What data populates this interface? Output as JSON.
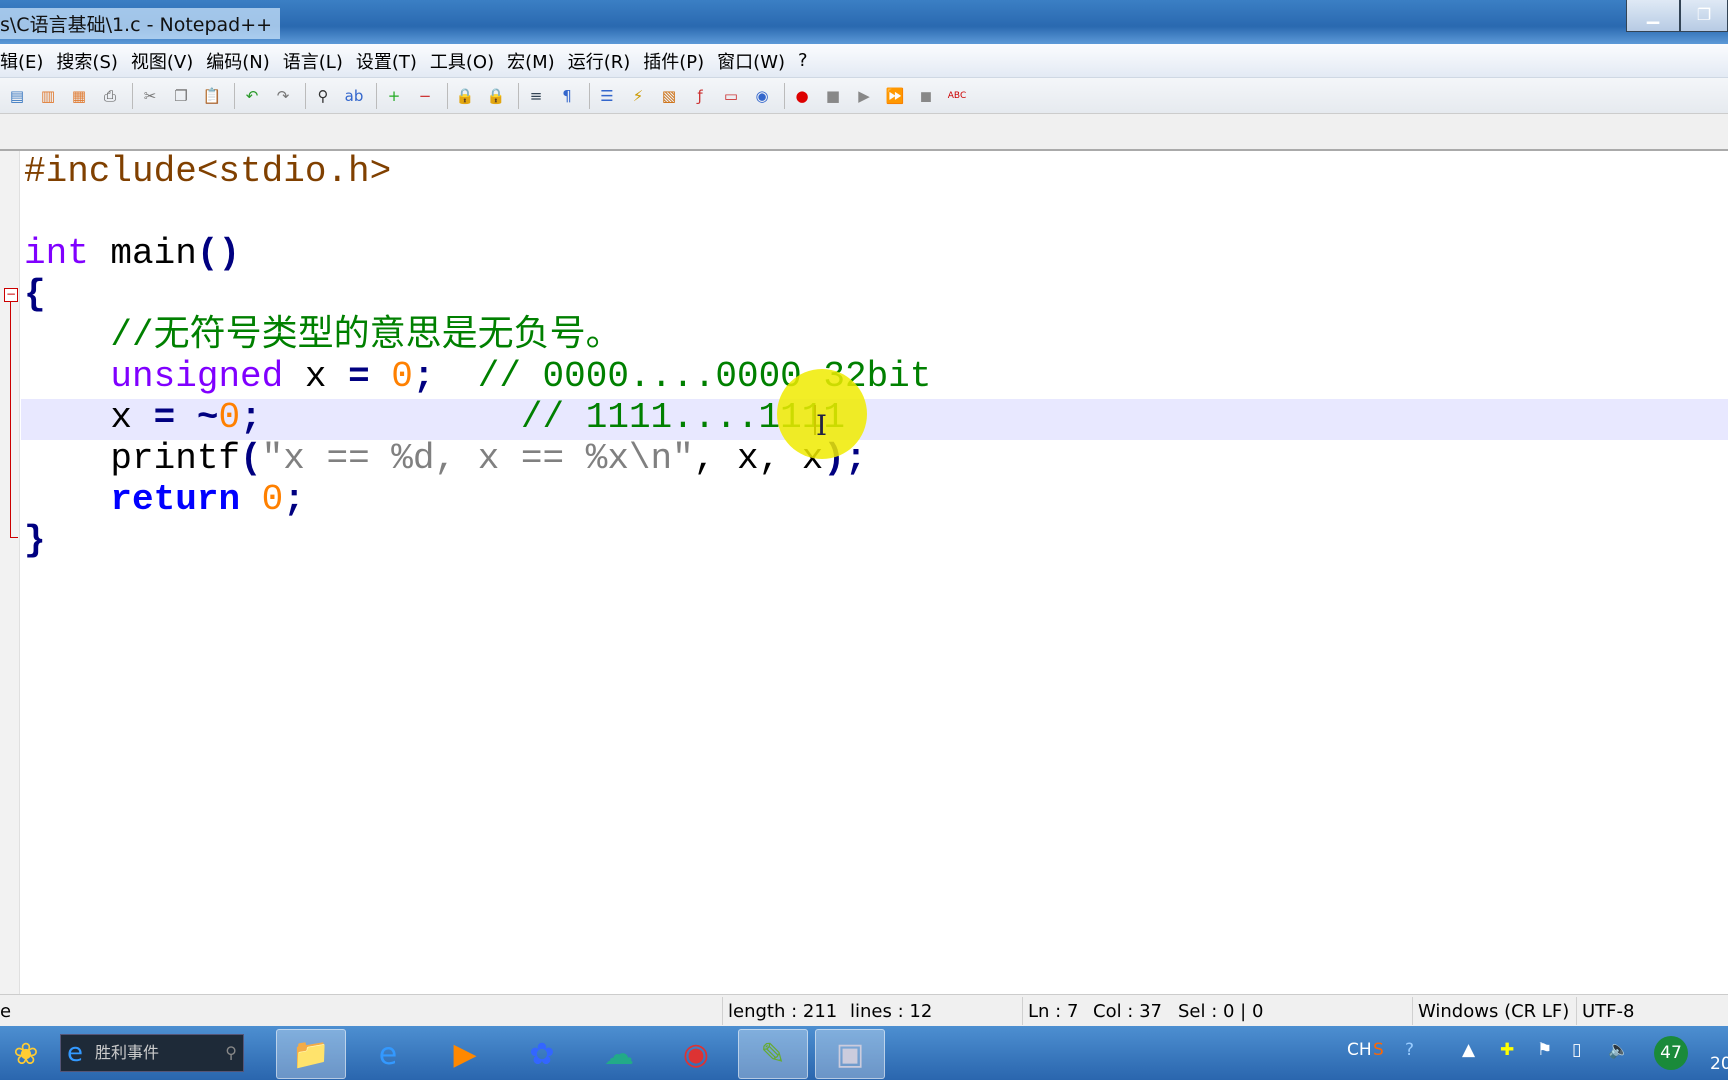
{
  "window": {
    "title": "s\\C语言基础\\1.c - Notepad++",
    "minimize_icon": "minimize-icon",
    "restore_icon": "restore-icon"
  },
  "menu": [
    "辑(E)",
    "搜索(S)",
    "视图(V)",
    "编码(N)",
    "语言(L)",
    "设置(T)",
    "工具(O)",
    "宏(M)",
    "运行(R)",
    "插件(P)",
    "窗口(W)",
    "?"
  ],
  "toolbar": [
    {
      "icon": "new-file-icon",
      "glyph": "▤",
      "color": "#3a78c0"
    },
    {
      "icon": "open-file-icon",
      "glyph": "▥",
      "color": "#e07a30"
    },
    {
      "icon": "save-icon",
      "glyph": "▦",
      "color": "#e07a30"
    },
    {
      "icon": "print-icon",
      "glyph": "⎙",
      "color": "#555"
    },
    {
      "icon": "cut-icon",
      "glyph": "✂",
      "color": "#777"
    },
    {
      "icon": "copy-icon",
      "glyph": "❐",
      "color": "#777"
    },
    {
      "icon": "paste-icon",
      "glyph": "📋",
      "color": "#c90"
    },
    {
      "icon": "undo-icon",
      "glyph": "↶",
      "color": "#2a9a2a"
    },
    {
      "icon": "redo-icon",
      "glyph": "↷",
      "color": "#777"
    },
    {
      "icon": "find-icon",
      "glyph": "⚲",
      "color": "#333"
    },
    {
      "icon": "replace-icon",
      "glyph": "ab",
      "color": "#36c"
    },
    {
      "icon": "zoom-in-icon",
      "glyph": "+",
      "color": "#2a2"
    },
    {
      "icon": "zoom-out-icon",
      "glyph": "−",
      "color": "#c33"
    },
    {
      "icon": "sync-vertical-icon",
      "glyph": "🔒",
      "color": "#c90"
    },
    {
      "icon": "sync-horizontal-icon",
      "glyph": "🔒",
      "color": "#c90"
    },
    {
      "icon": "word-wrap-icon",
      "glyph": "≡",
      "color": "#345"
    },
    {
      "icon": "show-all-chars-icon",
      "glyph": "¶",
      "color": "#36c"
    },
    {
      "icon": "indent-guide-icon",
      "glyph": "☰",
      "color": "#36c"
    },
    {
      "icon": "udl-icon",
      "glyph": "⚡",
      "color": "#c90"
    },
    {
      "icon": "doc-map-icon",
      "glyph": "▧",
      "color": "#c60"
    },
    {
      "icon": "function-list-icon",
      "glyph": "ƒ",
      "color": "#c33"
    },
    {
      "icon": "folder-workspace-icon",
      "glyph": "▭",
      "color": "#c33"
    },
    {
      "icon": "monitoring-icon",
      "glyph": "◉",
      "color": "#36c"
    },
    {
      "icon": "record-macro-icon",
      "glyph": "●",
      "color": "#d00"
    },
    {
      "icon": "stop-macro-icon",
      "glyph": "■",
      "color": "#888"
    },
    {
      "icon": "play-macro-icon",
      "glyph": "▶",
      "color": "#888"
    },
    {
      "icon": "run-macro-multiple-icon",
      "glyph": "⏩",
      "color": "#36c"
    },
    {
      "icon": "save-macro-icon",
      "glyph": "◼",
      "color": "#888"
    },
    {
      "icon": "spell-check-icon",
      "glyph": "ABC",
      "color": "#c00"
    }
  ],
  "editor": {
    "lines": [
      [
        {
          "t": "#include<stdio.h>",
          "c": "pre"
        }
      ],
      [],
      [
        {
          "t": "int",
          "c": "kw"
        },
        {
          "t": " main"
        },
        {
          "t": "()",
          "c": "op"
        }
      ],
      [
        {
          "t": "{",
          "c": "op"
        }
      ],
      [
        {
          "t": "    "
        },
        {
          "t": "//无符号类型的意思是无负号。",
          "c": "cm"
        }
      ],
      [
        {
          "t": "    "
        },
        {
          "t": "unsigned",
          "c": "kw"
        },
        {
          "t": " x "
        },
        {
          "t": "=",
          "c": "op"
        },
        {
          "t": " "
        },
        {
          "t": "0",
          "c": "num"
        },
        {
          "t": ";",
          "c": "op"
        },
        {
          "t": "  "
        },
        {
          "t": "// 0000....0000 32bit",
          "c": "cm"
        }
      ],
      [
        {
          "t": "    x "
        },
        {
          "t": "=",
          "c": "op"
        },
        {
          "t": " "
        },
        {
          "t": "~",
          "c": "op"
        },
        {
          "t": "0",
          "c": "num"
        },
        {
          "t": ";",
          "c": "op"
        },
        {
          "t": "            "
        },
        {
          "t": "// 1111....1111",
          "c": "cm"
        }
      ],
      [
        {
          "t": "    printf"
        },
        {
          "t": "(",
          "c": "op"
        },
        {
          "t": "\"x == %d, x == %x\\n\"",
          "c": "str"
        },
        {
          "t": ","
        },
        {
          "t": " x"
        },
        {
          "t": ","
        },
        {
          "t": " x"
        },
        {
          "t": ")",
          "c": "op"
        },
        {
          "t": ";",
          "c": "op"
        }
      ],
      [
        {
          "t": "    "
        },
        {
          "t": "return",
          "c": "kw2"
        },
        {
          "t": " "
        },
        {
          "t": "0",
          "c": "num"
        },
        {
          "t": ";",
          "c": "op"
        }
      ],
      [
        {
          "t": "}",
          "c": "op"
        }
      ]
    ],
    "current_line_color": "#e8e8ff"
  },
  "status": {
    "left": "e",
    "length": "length : 211",
    "lines": "lines : 12",
    "ln": "Ln : 7",
    "col": "Col : 37",
    "sel": "Sel : 0 | 0",
    "eol": "Windows (CR LF)",
    "encoding": "UTF-8"
  },
  "taskbar": {
    "search_text": "胜利事件",
    "apps": [
      {
        "icon": "file-explorer-icon",
        "glyph": "📁"
      },
      {
        "icon": "internet-explorer-icon",
        "glyph": "e"
      },
      {
        "icon": "media-player-icon",
        "glyph": "▶"
      },
      {
        "icon": "baidu-netdisk-icon",
        "glyph": "✿"
      },
      {
        "icon": "cloud-icon",
        "glyph": "☁"
      },
      {
        "icon": "chrome-icon",
        "glyph": "◉"
      },
      {
        "icon": "notepad-plus-plus-icon",
        "glyph": "✎"
      },
      {
        "icon": "window-app-icon",
        "glyph": "▣"
      }
    ],
    "tray": {
      "ime": "CH",
      "badge": "47",
      "clock_partial": "20"
    }
  }
}
